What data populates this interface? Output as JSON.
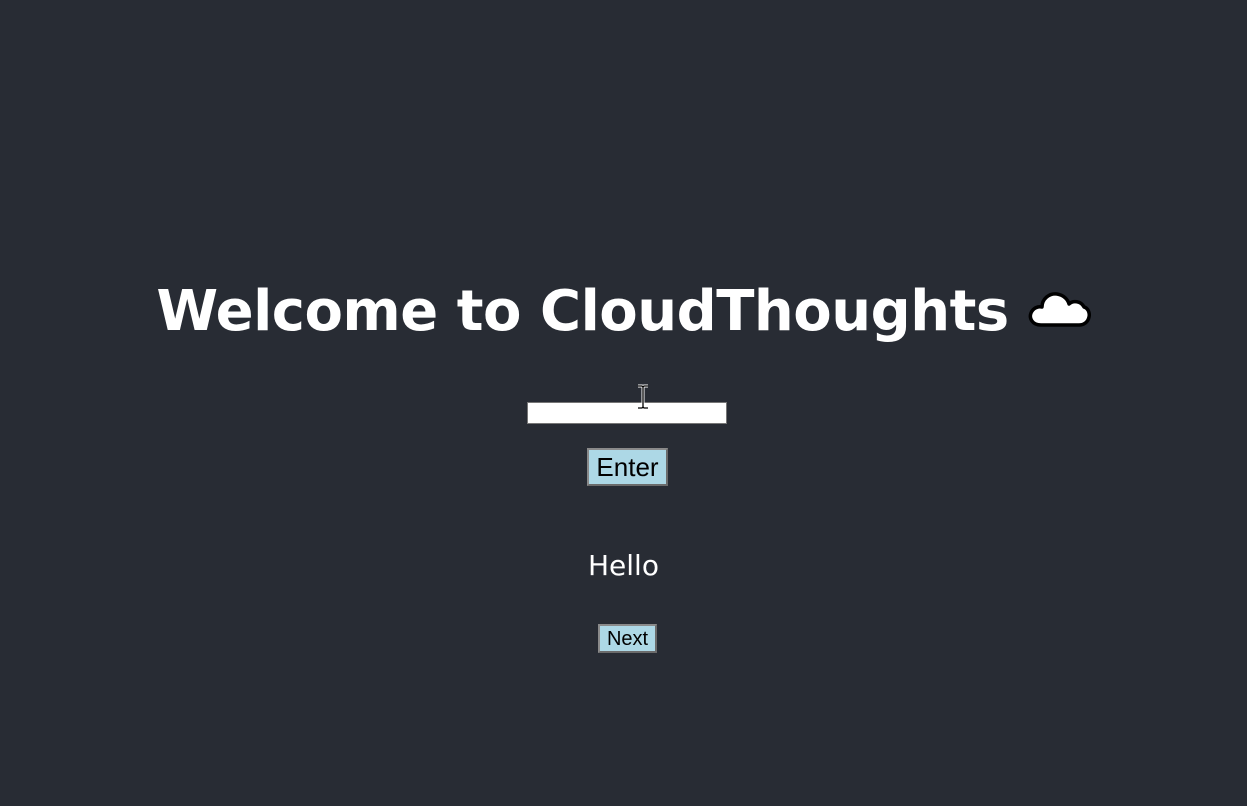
{
  "app": {
    "title": "Welcome to CloudThoughts",
    "title_icon": "cloud-icon"
  },
  "form": {
    "input_value": "",
    "enter_label": "Enter"
  },
  "output": {
    "message": "Hello",
    "next_label": "Next"
  },
  "colors": {
    "background": "#282c34",
    "text": "#ffffff",
    "button_bg": "#add8e6"
  }
}
